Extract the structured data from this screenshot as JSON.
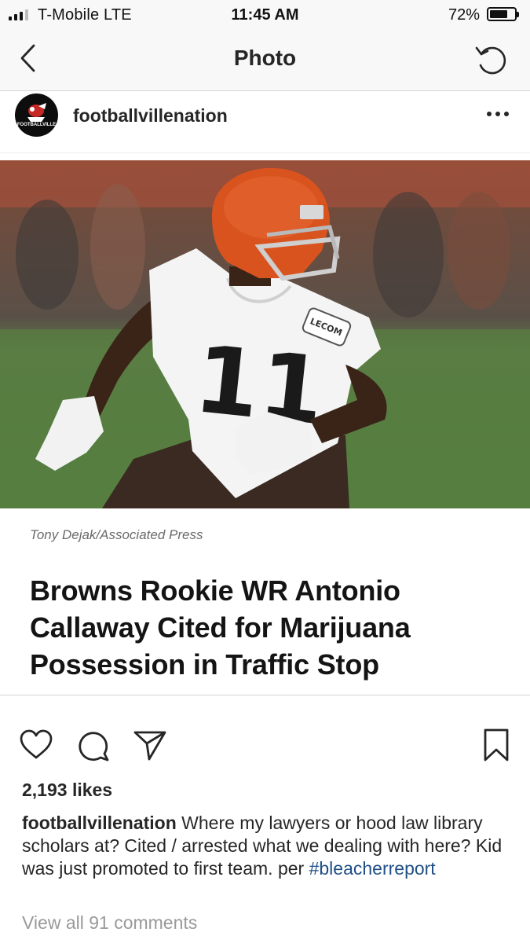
{
  "status_bar": {
    "carrier": "T-Mobile  LTE",
    "time": "11:45 AM",
    "battery_percent": "72%",
    "battery_level": 0.72,
    "signal_bars_filled": 3,
    "signal_bars_total": 4
  },
  "nav": {
    "back_icon": "chevron-left-icon",
    "title": "Photo",
    "refresh_icon": "refresh-icon"
  },
  "post": {
    "username": "footballvillenation",
    "avatar_logo_text": "FOOTBALLVILLE",
    "more_icon": "ellipsis-icon",
    "image": {
      "jersey_number": "11",
      "jersey_patch": "LECOM",
      "photo_credit": "Tony Dejak/Associated Press",
      "headline": "Browns Rookie WR Antonio Callaway Cited for Marijuana Possession in Traffic Stop"
    },
    "actions": {
      "like_icon": "heart-icon",
      "comment_icon": "comment-icon",
      "share_icon": "paper-plane-icon",
      "save_icon": "bookmark-icon"
    },
    "likes": "2,193 likes",
    "caption": {
      "user": "footballvillenation",
      "text": " Where my lawyers or hood law library scholars at? Cited / arrested what we dealing with here? Kid was just promoted to first team. per ",
      "hashtag": "#bleacherreport"
    },
    "view_comments": "View all 91 comments"
  },
  "colors": {
    "hashtag": "#1f4f86",
    "muted_text": "#9a9a9a",
    "text": "#262626",
    "helmet_orange": "#d9531e",
    "turf_green": "#4f7d3b"
  }
}
